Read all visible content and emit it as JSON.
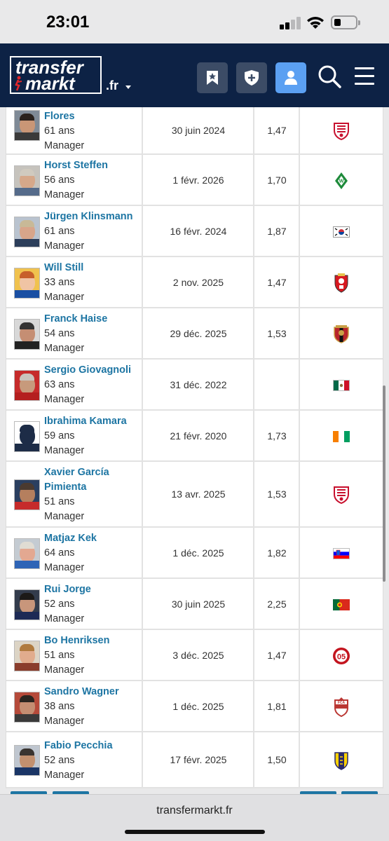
{
  "status_bar": {
    "time": "23:01"
  },
  "header": {
    "logo_line1": "transfer",
    "logo_line2": "markt",
    "tld": ".fr",
    "buttons": [
      "bookmark-star",
      "shield-plus",
      "user",
      "search",
      "menu"
    ]
  },
  "rows": [
    {
      "name": "Flores",
      "age": "61 ans",
      "role": "Manager",
      "date": "30 juin 2024",
      "ratio": "1,47",
      "club_icon": "sevilla-crest"
    },
    {
      "name": "Horst Steffen",
      "age": "56 ans",
      "role": "Manager",
      "date": "1 févr. 2026",
      "ratio": "1,70",
      "club_icon": "werder-bremen-crest"
    },
    {
      "name": "Jürgen Klinsmann",
      "age": "61 ans",
      "role": "Manager",
      "date": "16 févr. 2024",
      "ratio": "1,87",
      "club_icon": "south-korea-flag"
    },
    {
      "name": "Will Still",
      "age": "33 ans",
      "role": "Manager",
      "date": "2 nov. 2025",
      "ratio": "1,47",
      "club_icon": "southampton-crest"
    },
    {
      "name": "Franck Haise",
      "age": "54 ans",
      "role": "Manager",
      "date": "29 déc. 2025",
      "ratio": "1,53",
      "club_icon": "nice-crest"
    },
    {
      "name": "Sergio Giovagnoli",
      "age": "63 ans",
      "role": "Manager",
      "date": "31 déc. 2022",
      "ratio": "",
      "club_icon": "mexico-flag"
    },
    {
      "name": "Ibrahima Kamara",
      "age": "59 ans",
      "role": "Manager",
      "date": "21 févr. 2020",
      "ratio": "1,73",
      "club_icon": "ivory-coast-flag"
    },
    {
      "name_line1": "Xavier García",
      "name_line2": "Pimienta",
      "age": "51 ans",
      "role": "Manager",
      "date": "13 avr. 2025",
      "ratio": "1,53",
      "club_icon": "sevilla-crest"
    },
    {
      "name": "Matjaz Kek",
      "age": "64 ans",
      "role": "Manager",
      "date": "1 déc. 2025",
      "ratio": "1,82",
      "club_icon": "slovenia-flag"
    },
    {
      "name": "Rui Jorge",
      "age": "52 ans",
      "role": "Manager",
      "date": "30 juin 2025",
      "ratio": "2,25",
      "club_icon": "portugal-flag"
    },
    {
      "name": "Bo Henriksen",
      "age": "51 ans",
      "role": "Manager",
      "date": "3 déc. 2025",
      "ratio": "1,47",
      "club_icon": "mainz-crest"
    },
    {
      "name": "Sandro Wagner",
      "age": "38 ans",
      "role": "Manager",
      "date": "1 déc. 2025",
      "ratio": "1,81",
      "club_icon": "augsburg-crest"
    },
    {
      "name": "Fabio Pecchia",
      "age": "52 ans",
      "role": "Manager",
      "date": "17 févr. 2025",
      "ratio": "1,50",
      "club_icon": "parma-crest"
    }
  ],
  "browser": {
    "url": "transfermarkt.fr"
  },
  "colors": {
    "header_bg": "#0d2245",
    "link": "#1d75a3",
    "active_button": "#5ba0f2"
  }
}
